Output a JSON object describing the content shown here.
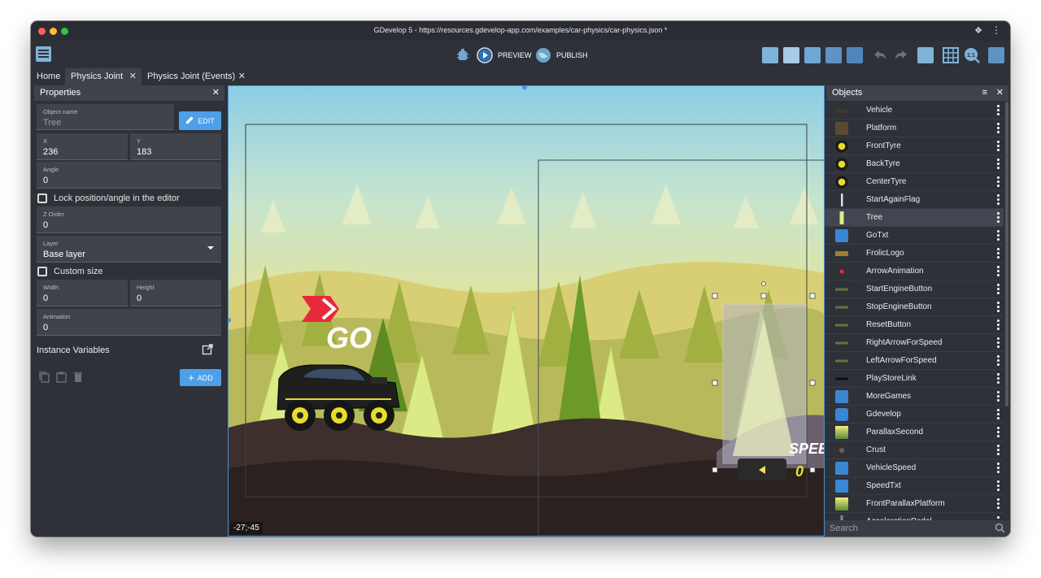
{
  "window": {
    "title": "GDevelop 5 - https://resources.gdevelop-app.com/examples/car-physics/car-physics.json *"
  },
  "toolbar": {
    "preview_label": "PREVIEW",
    "publish_label": "PUBLISH"
  },
  "tabs": [
    {
      "label": "Home",
      "active": false,
      "closable": false
    },
    {
      "label": "Physics Joint",
      "active": true,
      "closable": true
    },
    {
      "label": "Physics Joint (Events)",
      "active": false,
      "closable": true
    }
  ],
  "properties": {
    "title": "Properties",
    "object_name_label": "Object name",
    "object_name": "Tree",
    "edit_label": "EDIT",
    "x_label": "X",
    "x": "236",
    "y_label": "Y",
    "y": "183",
    "angle_label": "Angle",
    "angle": "0",
    "lock_label": "Lock position/angle in the editor",
    "z_order_label": "Z Order",
    "z_order": "0",
    "layer_label": "Layer",
    "layer": "Base layer",
    "custom_size_label": "Custom size",
    "width_label": "Width",
    "width": "0",
    "height_label": "Height",
    "height": "0",
    "animation_label": "Animation",
    "animation": "0",
    "instance_variables_label": "Instance Variables",
    "add_label": "ADD"
  },
  "scene": {
    "go_text": "GO",
    "speed_text": "SPEE",
    "speed_value": "0",
    "coordinates": "-27;-45"
  },
  "objects": {
    "title": "Objects",
    "selected": "Tree",
    "items": [
      {
        "name": "Vehicle",
        "icon": "vehicle-thumb"
      },
      {
        "name": "Platform",
        "icon": "platform-thumb"
      },
      {
        "name": "FrontTyre",
        "icon": "tyre-thumb"
      },
      {
        "name": "BackTyre",
        "icon": "tyre-thumb"
      },
      {
        "name": "CenterTyre",
        "icon": "tyre-thumb"
      },
      {
        "name": "StartAgainFlag",
        "icon": "flag-thumb"
      },
      {
        "name": "Tree",
        "icon": "tree-thumb"
      },
      {
        "name": "GoTxt",
        "icon": "text-object-icon"
      },
      {
        "name": "FrolicLogo",
        "icon": "logo-thumb"
      },
      {
        "name": "ArrowAnimation",
        "icon": "arrow-thumb"
      },
      {
        "name": "StartEngineButton",
        "icon": "button-thumb"
      },
      {
        "name": "StopEngineButton",
        "icon": "button-thumb"
      },
      {
        "name": "ResetButton",
        "icon": "button-thumb"
      },
      {
        "name": "RightArrowForSpeed",
        "icon": "button-thumb"
      },
      {
        "name": "LeftArrowForSpeed",
        "icon": "button-thumb"
      },
      {
        "name": "PlayStoreLink",
        "icon": "link-thumb"
      },
      {
        "name": "MoreGames",
        "icon": "text-object-icon"
      },
      {
        "name": "Gdevelop",
        "icon": "gdevelop-logo-icon"
      },
      {
        "name": "ParallaxSecond",
        "icon": "parallax-thumb"
      },
      {
        "name": "Crust",
        "icon": "crust-thumb"
      },
      {
        "name": "VehicleSpeed",
        "icon": "text-object-icon"
      },
      {
        "name": "SpeedTxt",
        "icon": "text-object-icon"
      },
      {
        "name": "FrontParallaxPlatform",
        "icon": "parallax-thumb"
      },
      {
        "name": "AccelerationPedal",
        "icon": "pedal-thumb"
      }
    ],
    "search_placeholder": "Search"
  },
  "colors": {
    "accent": "#4d9fe8",
    "panel_bg": "#2e3138",
    "field_bg": "#40434a"
  }
}
